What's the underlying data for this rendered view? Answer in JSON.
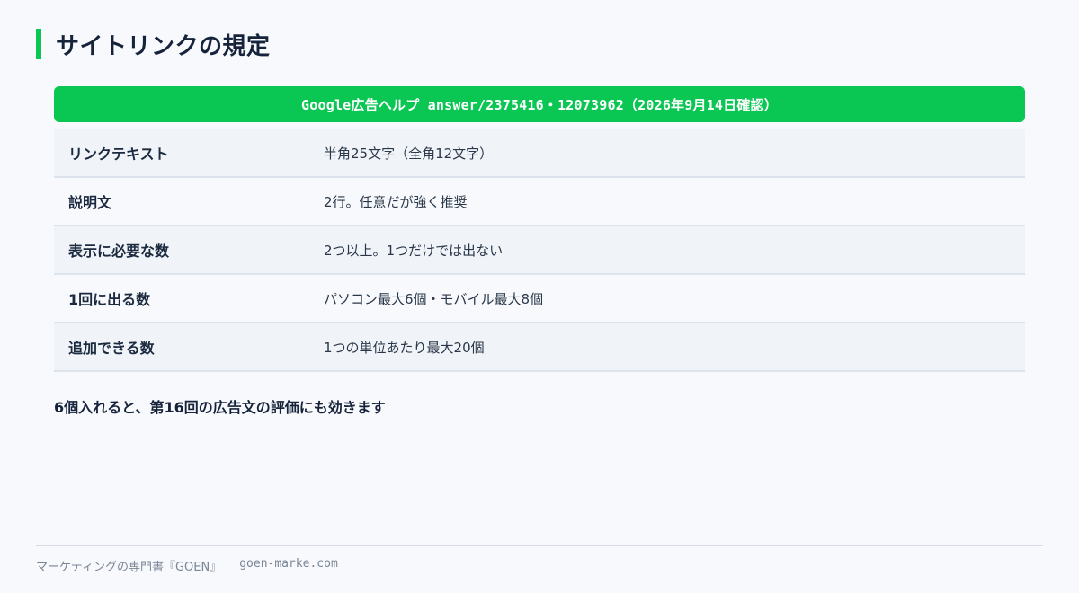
{
  "title": "サイトリンクの規定",
  "table": {
    "header": "Google広告ヘルプ answer/2375416・12073962（2026年9月14日確認）",
    "rows": [
      {
        "label": "リンクテキスト",
        "value": "半角25文字（全角12文字）"
      },
      {
        "label": "説明文",
        "value": "2行。任意だが強く推奨"
      },
      {
        "label": "表示に必要な数",
        "value": "2つ以上。1つだけでは出ない"
      },
      {
        "label": "1回に出る数",
        "value": "パソコン最大6個・モバイル最大8個"
      },
      {
        "label": "追加できる数",
        "value": "1つの単位あたり最大20個"
      }
    ]
  },
  "note": "6個入れると、第16回の広告文の評価にも効きます",
  "footer": {
    "brand": "マーケティングの専門書『GOEN』",
    "url": "goen-marke.com"
  },
  "colors": {
    "accent": "#0ac653",
    "text": "#16233a",
    "row_alt": "#f0f3f8"
  }
}
